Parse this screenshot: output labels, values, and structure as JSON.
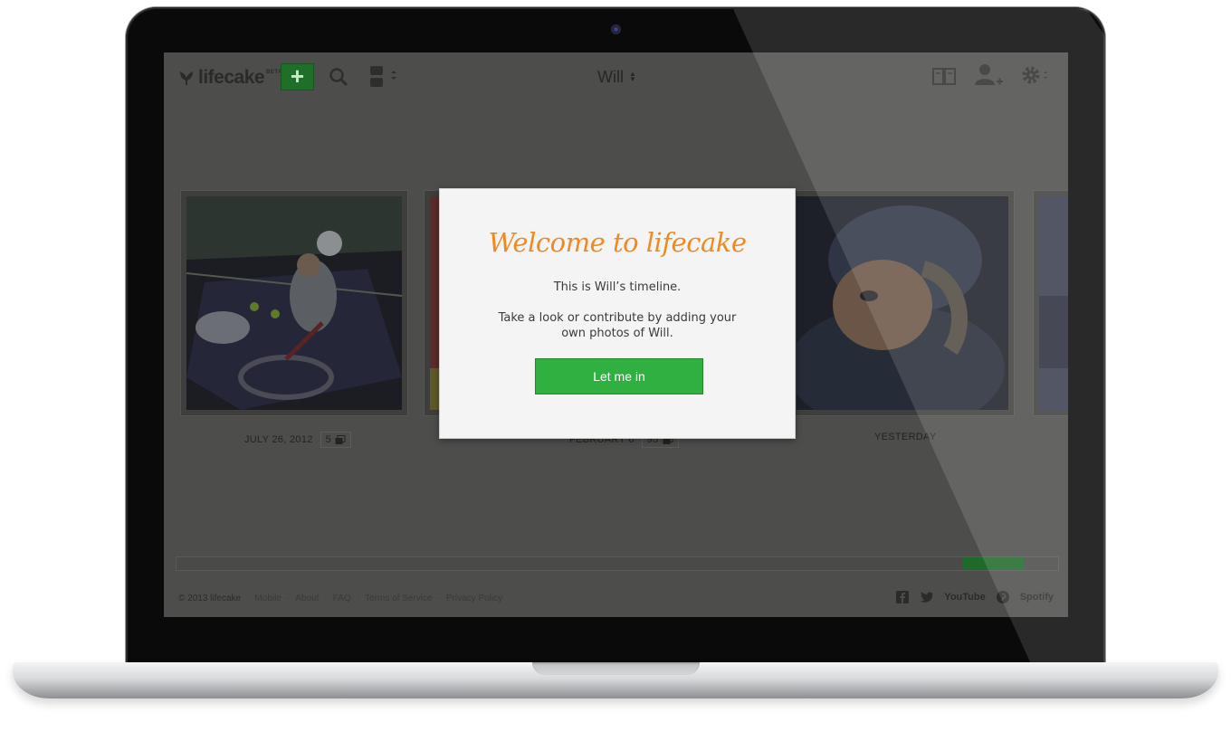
{
  "header": {
    "brand": "lifecake",
    "beta": "BETA",
    "add_label": "+",
    "child_name": "Will"
  },
  "timeline": {
    "entries": [
      {
        "date": "JULY 26, 2012",
        "count": "5"
      },
      {
        "date": "FEBRUARY 6",
        "count": "95"
      },
      {
        "date": "YESTERDAY",
        "count": ""
      }
    ],
    "progress": 0.07
  },
  "modal": {
    "title": "Welcome to lifecake",
    "line1": "This is Will’s timeline.",
    "line2": "Take a look or contribute by adding your own photos of Will.",
    "button": "Let me in"
  },
  "footer": {
    "copyright": "© 2013 lifecake",
    "links": [
      "Mobile",
      "About",
      "FAQ",
      "Terms of Service",
      "Privacy Policy"
    ],
    "social": [
      "facebook-icon",
      "twitter-icon",
      "youtube-icon",
      "pinterest-icon",
      "spotify-icon"
    ],
    "youtube": "YouTube",
    "spotify": "Spotify"
  },
  "colors": {
    "brand_green": "#2fb040",
    "title_orange": "#ef8a23",
    "overlay": "#4d4d4b"
  }
}
